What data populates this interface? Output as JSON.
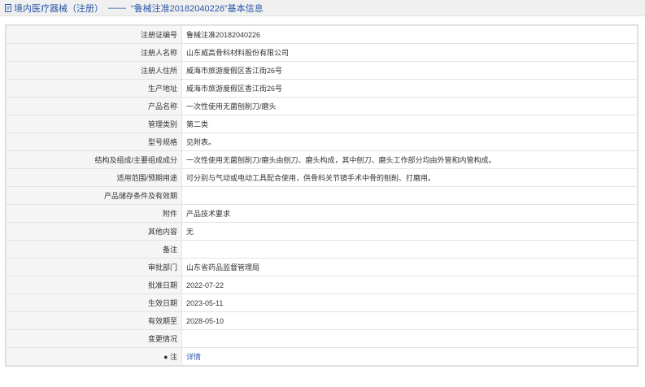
{
  "header": {
    "category": "境内医疗器械（注册）",
    "separator": "——",
    "title": "“鲁械注准20182040226”基本信息"
  },
  "rows": [
    {
      "label": "注册证编号",
      "value": "鲁械注准20182040226"
    },
    {
      "label": "注册人名称",
      "value": "山东威高骨科材料股份有限公司"
    },
    {
      "label": "注册人住所",
      "value": "威海市旅游度假区香江街26号"
    },
    {
      "label": "生产地址",
      "value": "威海市旅游度假区香江街26号"
    },
    {
      "label": "产品名称",
      "value": "一次性使用无菌刨削刀/磨头"
    },
    {
      "label": "管理类别",
      "value": "第二类"
    },
    {
      "label": "型号规格",
      "value": "见附表。"
    },
    {
      "label": "结构及组成/主要组成成分",
      "value": "一次性使用无菌刨削刀/磨头由刨刀、磨头构成，其中刨刀、磨头工作部分均由外管和内管构成。"
    },
    {
      "label": "适用范围/预期用途",
      "value": "可分别与气动或电动工具配合使用，供骨科关节镜手术中骨的刨削、打磨用。"
    },
    {
      "label": "产品储存条件及有效期",
      "value": ""
    },
    {
      "label": "附件",
      "value": "产品技术要求"
    },
    {
      "label": "其他内容",
      "value": "无"
    },
    {
      "label": "备注",
      "value": ""
    },
    {
      "label": "审批部门",
      "value": "山东省药品监督管理局"
    },
    {
      "label": "批准日期",
      "value": "2022-07-22"
    },
    {
      "label": "生效日期",
      "value": "2023-05-11"
    },
    {
      "label": "有效期至",
      "value": "2028-05-10"
    },
    {
      "label": "变更情况",
      "value": ""
    },
    {
      "label": "● 注",
      "value": "详情"
    }
  ]
}
